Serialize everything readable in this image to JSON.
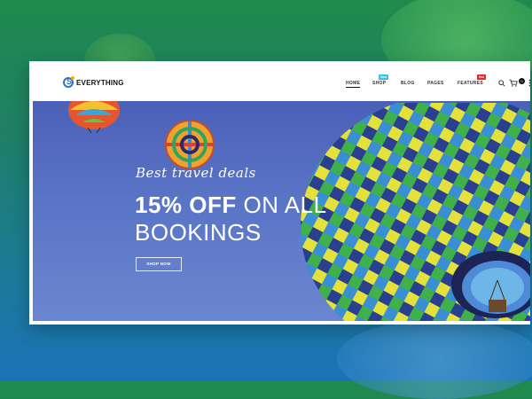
{
  "brand": {
    "name": "EVERYTHING",
    "mark": "S"
  },
  "nav": {
    "items": [
      {
        "label": "HOME",
        "active": true
      },
      {
        "label": "SHOP",
        "badge": "New"
      },
      {
        "label": "BLOG"
      },
      {
        "label": "PAGES"
      },
      {
        "label": "FEATURES",
        "badge": "Hot"
      }
    ],
    "cart_count": "0",
    "icons": [
      "search-icon",
      "cart-icon",
      "menu-dots-icon"
    ]
  },
  "hero": {
    "tagline": "Best travel deals",
    "headline_bold": "15% OFF",
    "headline_rest": "ON ALL",
    "headline_line2": "BOOKINGS",
    "cta_label": "SHOP NOW"
  },
  "colors": {
    "accent": "#2e6fd6",
    "badge_new": "#35c0e6",
    "badge_hot": "#e02a2a",
    "hero_sky": "#5a74c6"
  }
}
